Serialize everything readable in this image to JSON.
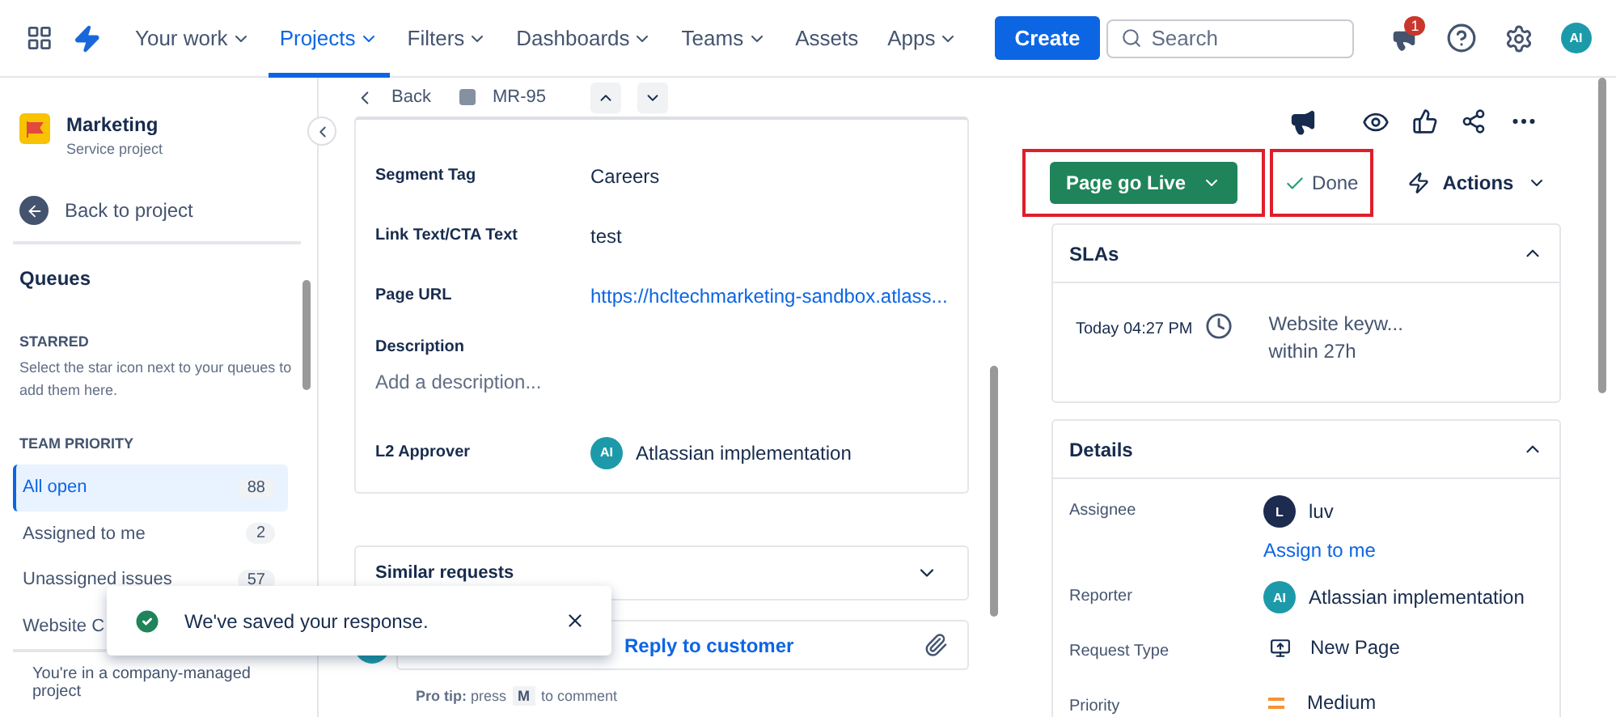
{
  "nav": {
    "items": [
      {
        "label": "Your work",
        "selected": false,
        "caret": true
      },
      {
        "label": "Projects",
        "selected": true,
        "caret": true
      },
      {
        "label": "Filters",
        "selected": false,
        "caret": true
      },
      {
        "label": "Dashboards",
        "selected": false,
        "caret": true
      },
      {
        "label": "Teams",
        "selected": false,
        "caret": true
      },
      {
        "label": "Assets",
        "selected": false,
        "caret": false
      },
      {
        "label": "Apps",
        "selected": false,
        "caret": true
      }
    ],
    "create": "Create",
    "search": {
      "placeholder": "Search"
    },
    "notification_count": "1",
    "avatar": "AI"
  },
  "sidebar": {
    "project": "Marketing",
    "project_type": "Service project",
    "back": "Back to project",
    "queues_title": "Queues",
    "starred_title": "STARRED",
    "starred_hint": "Select the star icon next to your queues to add them here.",
    "team_title": "TEAM PRIORITY",
    "queues": [
      {
        "label": "All open",
        "count": "88",
        "selected": true
      },
      {
        "label": "Assigned to me",
        "count": "2",
        "selected": false
      },
      {
        "label": "Unassigned issues",
        "count": "57",
        "selected": false
      },
      {
        "label": "Website C",
        "selected": false
      }
    ],
    "footer": "You're in a company-managed project"
  },
  "issue": {
    "back": "Back",
    "key": "MR-95",
    "fields": [
      {
        "label": "Segment Tag",
        "value": "Careers",
        "kind": "text"
      },
      {
        "label": "Link Text/CTA Text",
        "value": "test",
        "kind": "text"
      },
      {
        "label": "Page URL",
        "value": "https://hcltechmarketing-sandbox.atlass...",
        "kind": "link"
      },
      {
        "label": "Description",
        "value": "Add a description...",
        "kind": "stacked"
      },
      {
        "label": "L2 Approver",
        "value": "Atlassian implementation",
        "kind": "user",
        "initials": "AI",
        "color": "#1d9aaa"
      }
    ],
    "similar": "Similar requests",
    "reply": "Reply to customer",
    "tip": "**Pro tip:** press",
    "tip_key": "M",
    "tip_end": "to comment"
  },
  "panel": {
    "status": "Page go Live",
    "resolution": "Done",
    "actions": "Actions",
    "sla": {
      "title": "SLAs",
      "time": "Today 04:27 PM",
      "name": "Website keyw...",
      "target": "within 27h"
    },
    "details": {
      "title": "Details",
      "rows": [
        {
          "label": "Assignee",
          "kind": "user",
          "value": "luv",
          "initials": "L",
          "color": "#1d2b4f",
          "link": "Assign to me"
        },
        {
          "label": "Reporter",
          "kind": "user",
          "value": "Atlassian implementation",
          "initials": "AI",
          "color": "#1d9aaa"
        },
        {
          "label": "Request Type",
          "kind": "type",
          "value": "New Page"
        },
        {
          "label": "Priority",
          "kind": "priority",
          "value": "Medium"
        }
      ]
    }
  },
  "toast": {
    "message": "We've saved your response."
  }
}
